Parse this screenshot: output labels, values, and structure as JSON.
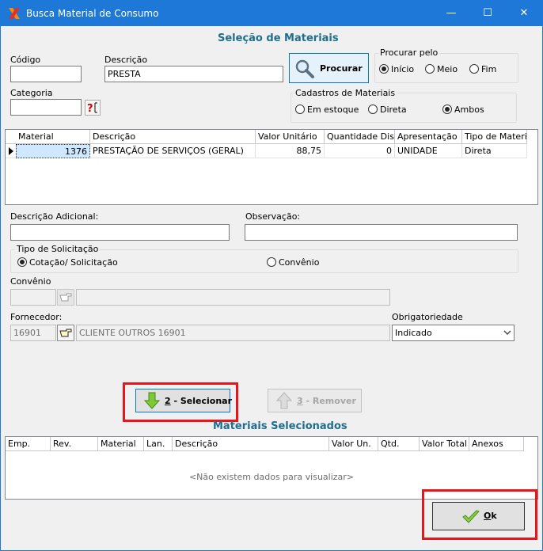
{
  "window": {
    "title": "Busca Material de Consumo",
    "minimize": "—",
    "maximize": "☐",
    "close": "✕"
  },
  "selecao": {
    "title": "Seleção de Materiais",
    "codigo_label": "Código",
    "codigo_value": "",
    "descricao_label": "Descrição",
    "descricao_value": "PRESTA",
    "categoria_label": "Categoria",
    "categoria_value": "",
    "procurar_button": "Procurar",
    "procurar_pelo": {
      "label": "Procurar pelo",
      "options": [
        "Início",
        "Meio",
        "Fim"
      ],
      "selected": "Início"
    },
    "cadastros": {
      "label": "Cadastros de Materiais",
      "options": [
        "Em estoque",
        "Direta",
        "Ambos"
      ],
      "selected": "Ambos"
    }
  },
  "materials_table": {
    "columns": [
      "Material",
      "Descrição",
      "Valor Unitário",
      "Quantidade Disp.",
      "Apresentação",
      "Tipo de Material"
    ],
    "rows": [
      {
        "material": "1376",
        "descricao": "PRESTAÇÃO DE SERVIÇOS (GERAL)",
        "valor_unitario": "88,75",
        "quantidade": "0",
        "apresentacao": "UNIDADE",
        "tipo": "Direta"
      }
    ]
  },
  "details": {
    "descricao_adicional_label": "Descrição Adicional:",
    "descricao_adicional_value": "",
    "observacao_label": "Observação:",
    "observacao_value": "",
    "tipo_solicitacao": {
      "label": "Tipo de Solicitação",
      "options": [
        "Cotação/ Solicitação",
        "Convênio"
      ],
      "selected": "Cotação/ Solicitação"
    },
    "convenio_label": "Convênio",
    "convenio_code": "",
    "convenio_name": "",
    "fornecedor_label": "Fornecedor:",
    "fornecedor_code": "16901",
    "fornecedor_name": "CLIENTE OUTROS 16901",
    "obrigatoriedade_label": "Obrigatoriedade",
    "obrigatoriedade_value": "Indicado"
  },
  "actions": {
    "selecionar_key": "2",
    "selecionar_label": " - Selecionar",
    "remover_key": "3",
    "remover_label": " - Remover"
  },
  "selected_table": {
    "title": "Materiais Selecionados",
    "columns": [
      "Emp.",
      "Rev.",
      "Material",
      "Lan.",
      "Descrição",
      "Valor Un.",
      "Qtd.",
      "Valor Total",
      "Anexos"
    ],
    "empty_text": "<Não existem dados para visualizar>"
  },
  "ok": {
    "key": "O",
    "label": "k"
  },
  "colors": {
    "title_bar": "#1e78d7",
    "section_title": "#1f6e8e",
    "highlight": "#e8161c",
    "selected_cell": "#cde8ff"
  }
}
